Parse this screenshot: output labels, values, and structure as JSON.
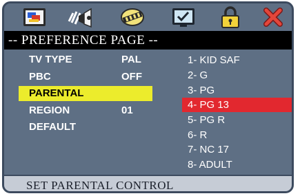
{
  "toolbar": {
    "icons": [
      {
        "name": "general-setup-icon"
      },
      {
        "name": "audio-setup-icon"
      },
      {
        "name": "video-setup-icon"
      },
      {
        "name": "preference-icon"
      },
      {
        "name": "password-lock-icon"
      },
      {
        "name": "exit-icon"
      }
    ]
  },
  "page": {
    "title": "-- PREFERENCE PAGE --"
  },
  "settings": {
    "tv_type": {
      "label": "TV TYPE",
      "value": "PAL"
    },
    "pbc": {
      "label": "PBC",
      "value": "OFF"
    },
    "parental": {
      "label": "PARENTAL"
    },
    "region": {
      "label": "REGION",
      "value": "01"
    },
    "default": {
      "label": "DEFAULT"
    }
  },
  "ratings": [
    "1- KID SAF",
    "2- G",
    "3- PG",
    "4- PG 13",
    "5- PG R",
    "6- R",
    "7- NC 17",
    "8- ADULT"
  ],
  "selected_rating_index": 3,
  "status": {
    "text": "SET PARENTAL CONTROL"
  },
  "colors": {
    "background": "#5e6f84",
    "highlight": "#ecec2c",
    "selected": "#e2282f",
    "titlebar": "#000000",
    "statusbar": "#c6ccd6"
  }
}
